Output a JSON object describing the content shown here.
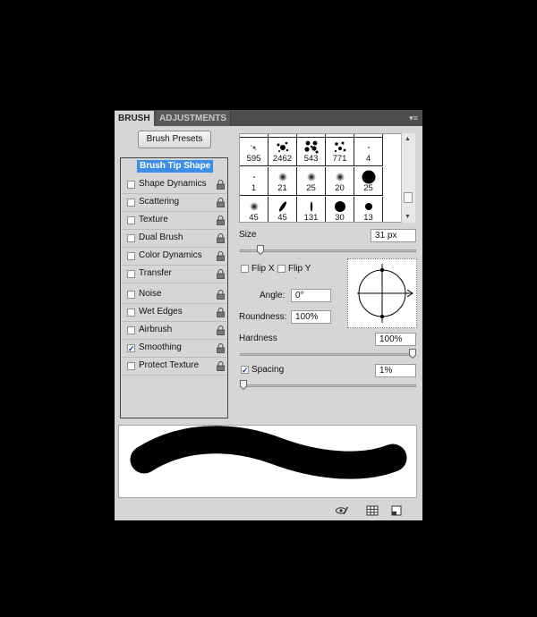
{
  "tabs": {
    "brush": "BRUSH",
    "adjustments": "ADJUSTMENTS"
  },
  "brush_presets_button": "Brush Presets",
  "options": [
    {
      "label": "Brush Tip Shape",
      "selected": true
    },
    {
      "label": "Shape Dynamics",
      "checked": false
    },
    {
      "label": "Scattering",
      "checked": false
    },
    {
      "label": "Texture",
      "checked": false
    },
    {
      "label": "Dual Brush",
      "checked": false
    },
    {
      "label": "Color Dynamics",
      "checked": false
    },
    {
      "label": "Transfer",
      "checked": false
    },
    {
      "label": "Noise",
      "checked": false
    },
    {
      "label": "Wet Edges",
      "checked": false
    },
    {
      "label": "Airbrush",
      "checked": false
    },
    {
      "label": "Smoothing",
      "checked": true
    },
    {
      "label": "Protect Texture",
      "checked": false
    }
  ],
  "brush_tips": [
    {
      "size": "595",
      "shape": "sparkle"
    },
    {
      "size": "2462",
      "shape": "splatter"
    },
    {
      "size": "543",
      "shape": "dots"
    },
    {
      "size": "771",
      "shape": "dots-small"
    },
    {
      "size": "4",
      "shape": "dot-tiny"
    },
    {
      "size": "1",
      "shape": "dot-tiny"
    },
    {
      "size": "21",
      "shape": "soft-small"
    },
    {
      "size": "25",
      "shape": "soft-small"
    },
    {
      "size": "20",
      "shape": "soft-small"
    },
    {
      "size": "25",
      "shape": "hard-large"
    },
    {
      "size": "45",
      "shape": "soft-small"
    },
    {
      "size": "45",
      "shape": "leaf"
    },
    {
      "size": "131",
      "shape": "sliver"
    },
    {
      "size": "30",
      "shape": "hard-medium"
    },
    {
      "size": "13",
      "shape": "hard-small"
    }
  ],
  "size": {
    "label": "Size",
    "value": "31 px",
    "fraction": 0.1
  },
  "flip_x": {
    "label": "Flip X",
    "checked": false
  },
  "flip_y": {
    "label": "Flip Y",
    "checked": false
  },
  "angle": {
    "label": "Angle:",
    "value": "0°"
  },
  "roundness": {
    "label": "Roundness:",
    "value": "100%"
  },
  "hardness": {
    "label": "Hardness",
    "value": "100%",
    "fraction": 1.0
  },
  "spacing": {
    "label": "Spacing",
    "value": "1%",
    "checked": true,
    "fraction": 0.0
  },
  "bottom_icons": [
    "eye-brush-icon",
    "grid-icon",
    "new-preset-icon"
  ]
}
